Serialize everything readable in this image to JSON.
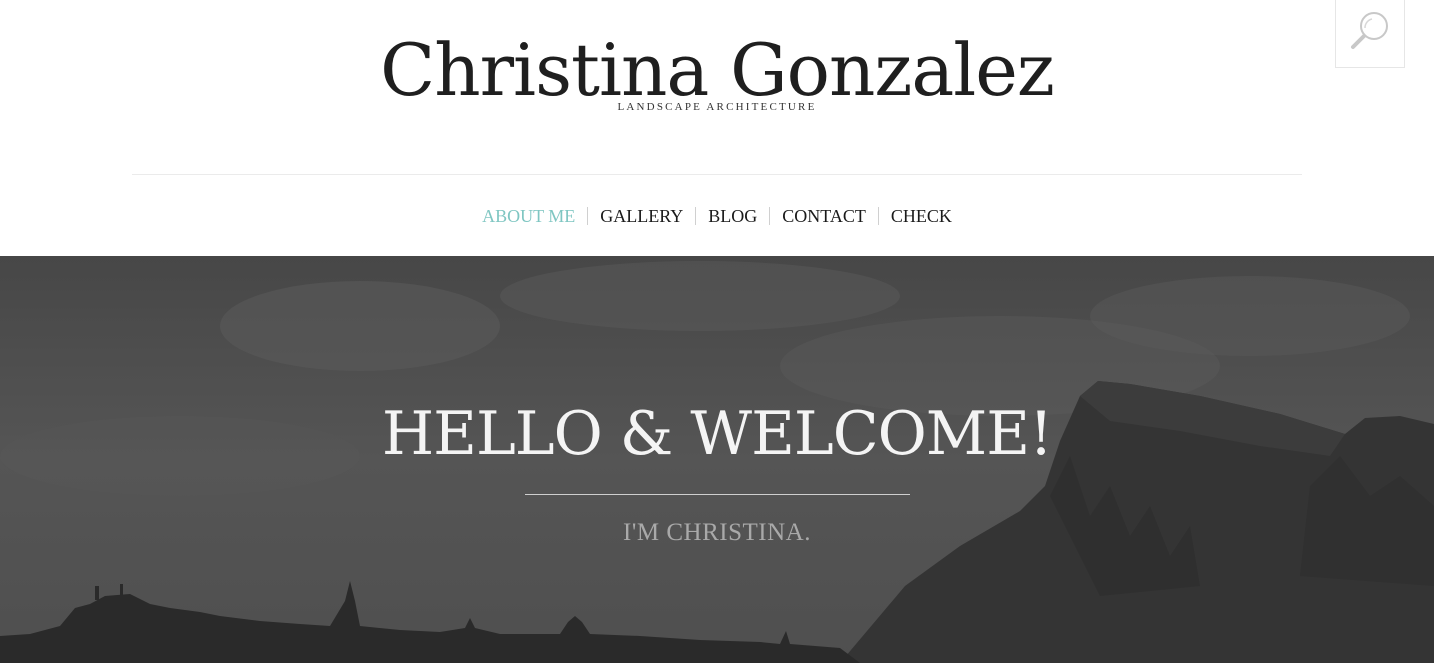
{
  "header": {
    "site_title": "Christina Gonzalez",
    "tagline": "LANDSCAPE ARCHITECTURE",
    "search_icon": "search-icon"
  },
  "nav": {
    "items": [
      {
        "label": "ABOUT ME",
        "active": true
      },
      {
        "label": "GALLERY",
        "active": false
      },
      {
        "label": "BLOG",
        "active": false
      },
      {
        "label": "CONTACT",
        "active": false
      },
      {
        "label": "CHECK",
        "active": false
      }
    ],
    "active_color": "#7fc6c2"
  },
  "hero": {
    "title": "HELLO & WELCOME!",
    "subtitle": "I'M CHRISTINA."
  }
}
